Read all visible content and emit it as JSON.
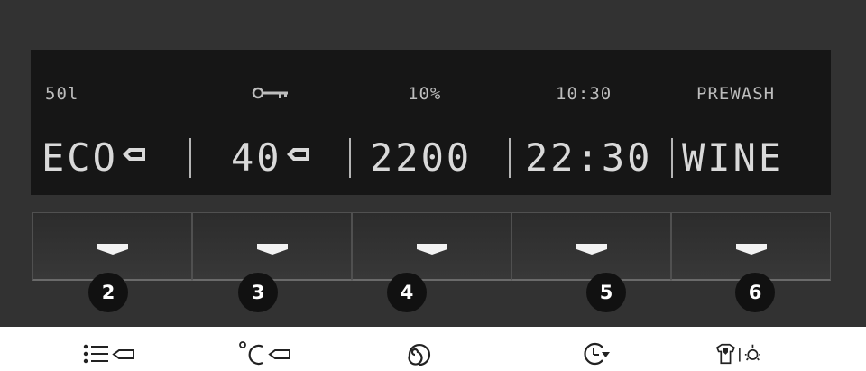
{
  "status_bar": {
    "water": "50l",
    "key": "lock-key-icon",
    "moisture": "10%",
    "time": "10:30",
    "option": "PREWASH"
  },
  "values": {
    "program": "ECO",
    "temperature": "40",
    "spin": "2200",
    "delay": "22:30",
    "extra": "WINE"
  },
  "buttons": [
    {
      "number": "2",
      "icon": "program-list-icon"
    },
    {
      "number": "3",
      "icon": "temperature-icon"
    },
    {
      "number": "4",
      "icon": "spin-icon"
    },
    {
      "number": "5",
      "icon": "delay-start-icon"
    },
    {
      "number": "6",
      "icon": "shirt-light-icon"
    }
  ],
  "colors": {
    "panel": "#323232",
    "screen": "#161616",
    "text": "#d9d9d9",
    "badge": "#111111"
  }
}
